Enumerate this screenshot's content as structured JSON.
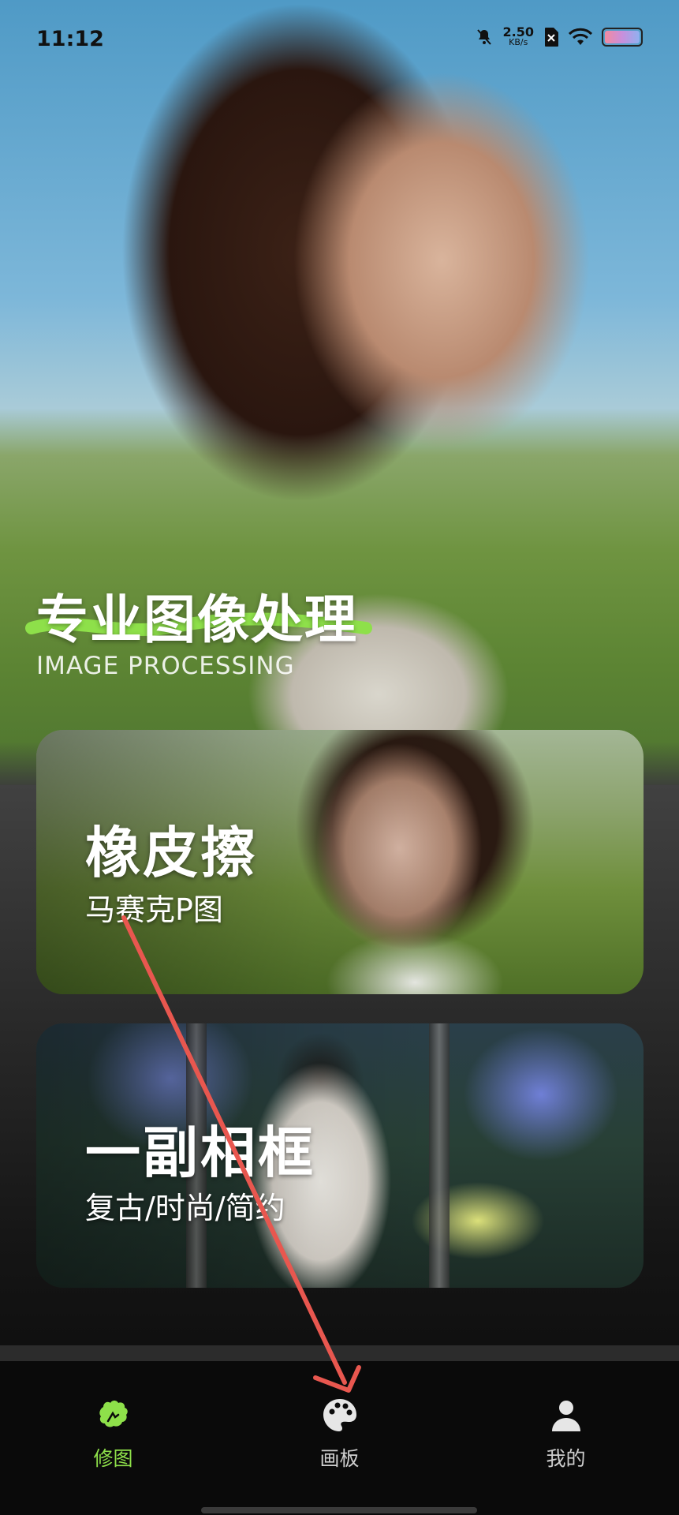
{
  "status_bar": {
    "time": "11:12",
    "net_speed_value": "2.50",
    "net_speed_unit": "KB/s",
    "icons": [
      "bell-off-icon",
      "sim-disabled-icon",
      "wifi-icon",
      "battery-icon"
    ]
  },
  "hero": {
    "title": "专业图像处理",
    "subtitle": "IMAGE PROCESSING",
    "accent_color": "#8ee04a"
  },
  "cards": [
    {
      "title": "橡皮擦",
      "subtitle": "马赛克P图"
    },
    {
      "title": "一副相框",
      "subtitle": "复古/时尚/简约"
    }
  ],
  "bottom_nav": {
    "items": [
      {
        "label": "修图",
        "icon": "retouch-icon",
        "active": true
      },
      {
        "label": "画板",
        "icon": "palette-icon",
        "active": false
      },
      {
        "label": "我的",
        "icon": "profile-icon",
        "active": false
      }
    ],
    "active_color": "#8ee04a",
    "inactive_color": "#cfcfcf"
  },
  "annotation": {
    "type": "arrow",
    "color": "#e8574f"
  }
}
